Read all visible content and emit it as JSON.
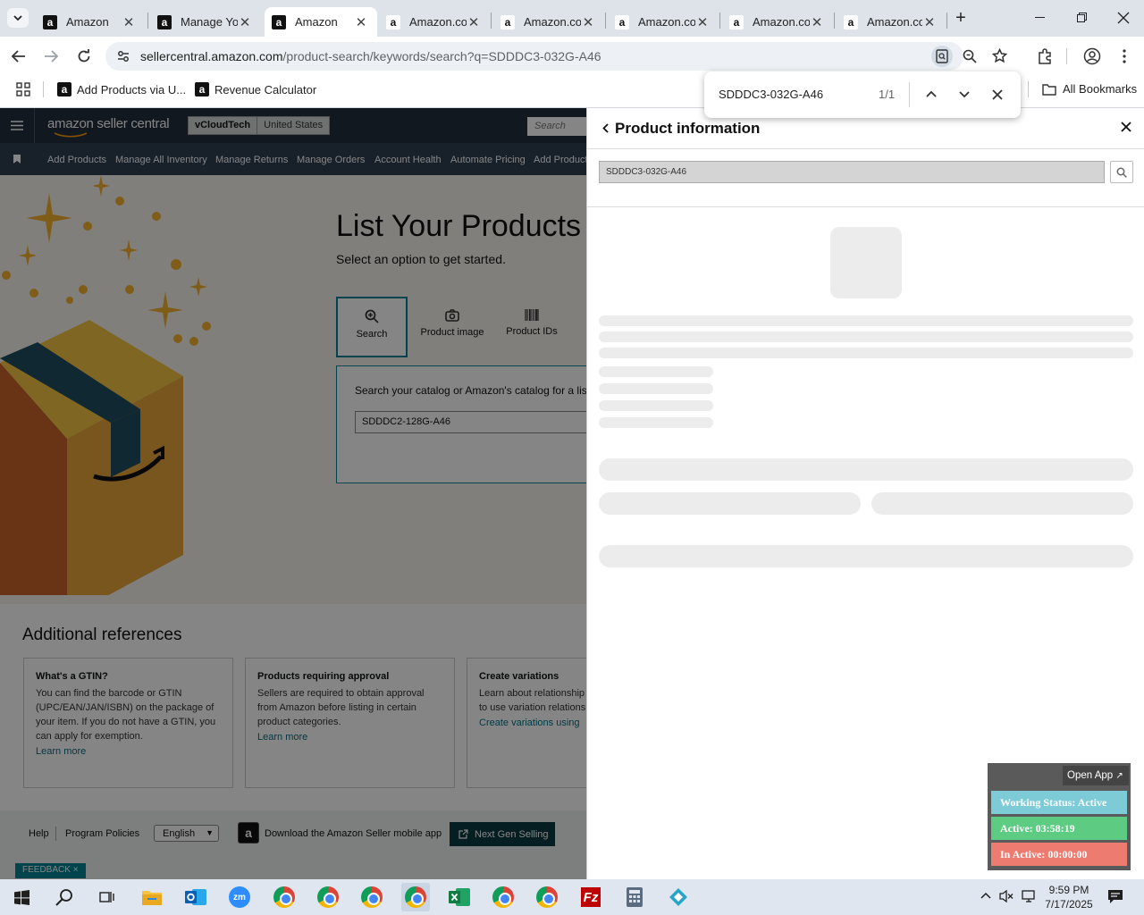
{
  "browser": {
    "tabs": [
      {
        "title": "Amazon",
        "icon": "amazon-a-icon"
      },
      {
        "title": "Manage Yo",
        "icon": "amazon-a-icon"
      },
      {
        "title": "Amazon",
        "icon": "amazon-a-icon",
        "active": true
      },
      {
        "title": "Amazon.co",
        "icon": "amazon-smile-icon"
      },
      {
        "title": "Amazon.co",
        "icon": "amazon-smile-icon"
      },
      {
        "title": "Amazon.co",
        "icon": "amazon-smile-icon"
      },
      {
        "title": "Amazon.co",
        "icon": "amazon-smile-icon"
      },
      {
        "title": "Amazon.co",
        "icon": "amazon-smile-icon"
      }
    ],
    "url_host": "sellercentral.amazon.com",
    "url_path": "/product-search/keywords/search?q=SDDDC3-032G-A46",
    "bookmarks": [
      {
        "label": "Add Products via U..."
      },
      {
        "label": "Revenue Calculator"
      }
    ],
    "all_bookmarks": "All Bookmarks",
    "find": {
      "query": "SDDDC3-032G-A46",
      "count": "1/1"
    }
  },
  "amazon": {
    "logo": "amazon seller central",
    "store": "vCloudTech",
    "marketplace": "United States",
    "search_placeholder": "Search",
    "nav": [
      "Add Products",
      "Manage All Inventory",
      "Manage Returns",
      "Manage Orders",
      "Account Health",
      "Automate Pricing",
      "Add Product"
    ],
    "hero_title": "List Your Products",
    "hero_subtitle": "Select an option to get started.",
    "options": [
      {
        "label": "Search",
        "icon": "search-zoom-icon"
      },
      {
        "label": "Product image",
        "icon": "camera-icon"
      },
      {
        "label": "Product IDs",
        "icon": "barcode-icon"
      }
    ],
    "search_label": "Search your catalog or Amazon's catalog for a listing",
    "search_value": "SDDDC2-128G-A46",
    "refs_title": "Additional references",
    "refs": [
      {
        "title": "What's a GTIN?",
        "body": "You can find the barcode or GTIN (UPC/EAN/JAN/ISBN) on the package of your item. If you do not have a GTIN, you can apply for exemption.",
        "link": "Learn more"
      },
      {
        "title": "Products requiring approval",
        "body": "Sellers are required to obtain approval from Amazon before listing in certain product categories.",
        "link": "Learn more"
      },
      {
        "title": "Create variations",
        "body": "Learn about relationship to use variation relations",
        "link": "Create variations using"
      }
    ],
    "footer": {
      "help": "Help",
      "policies": "Program Policies",
      "language": "English",
      "app": "Download the Amazon Seller mobile app",
      "next_gen": "Next Gen Selling",
      "feedback": "FEEDBACK"
    }
  },
  "panel": {
    "title": "Product information",
    "search_value": "SDDDC3-032G-A46"
  },
  "widget": {
    "open_app": "Open App",
    "status": "Working Status: Active",
    "active": "Active: 03:58:19",
    "inactive": "In Active: 00:00:00",
    "colors": {
      "status": "#7ecbd8",
      "active": "#5ecb83",
      "inactive": "#ee7b6f"
    }
  },
  "taskbar": {
    "time": "9:59 PM",
    "date": "7/17/2025"
  }
}
